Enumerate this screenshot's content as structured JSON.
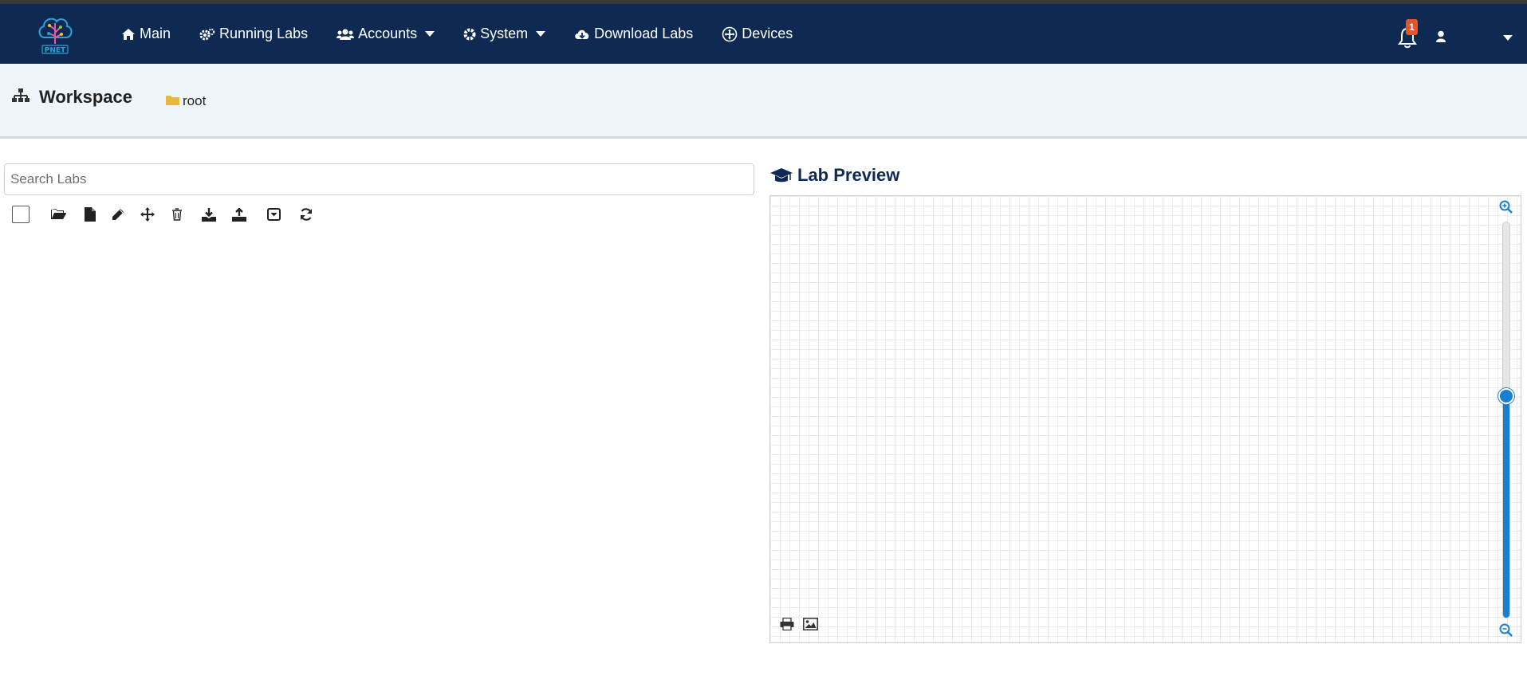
{
  "navbar": {
    "logo_text": "PNET",
    "items": [
      {
        "label": "Main",
        "icon": "home-icon"
      },
      {
        "label": "Running Labs",
        "icon": "gears-icon"
      },
      {
        "label": "Accounts",
        "icon": "users-icon",
        "dropdown": true
      },
      {
        "label": "System",
        "icon": "gear-icon",
        "dropdown": true
      },
      {
        "label": "Download Labs",
        "icon": "cloud-download-icon"
      },
      {
        "label": "Devices",
        "icon": "plus-circle-icon"
      }
    ],
    "notification_count": "1"
  },
  "workspace": {
    "title": "Workspace",
    "folder": "root"
  },
  "search": {
    "placeholder": "Search Labs",
    "value": ""
  },
  "toolbar": {
    "icons": [
      "select-all-checkbox",
      "open-folder-icon",
      "new-file-icon",
      "edit-icon",
      "move-icon",
      "delete-icon",
      "import-icon",
      "export-icon",
      "archive-icon",
      "refresh-icon"
    ]
  },
  "preview": {
    "title": "Lab Preview",
    "zoom_level": 0.56
  },
  "colors": {
    "navbar": "#0f2a52",
    "subheader": "#eef6fc",
    "accent": "#1a7fd1",
    "badge": "#e8542a",
    "folder": "#e6b93c"
  }
}
